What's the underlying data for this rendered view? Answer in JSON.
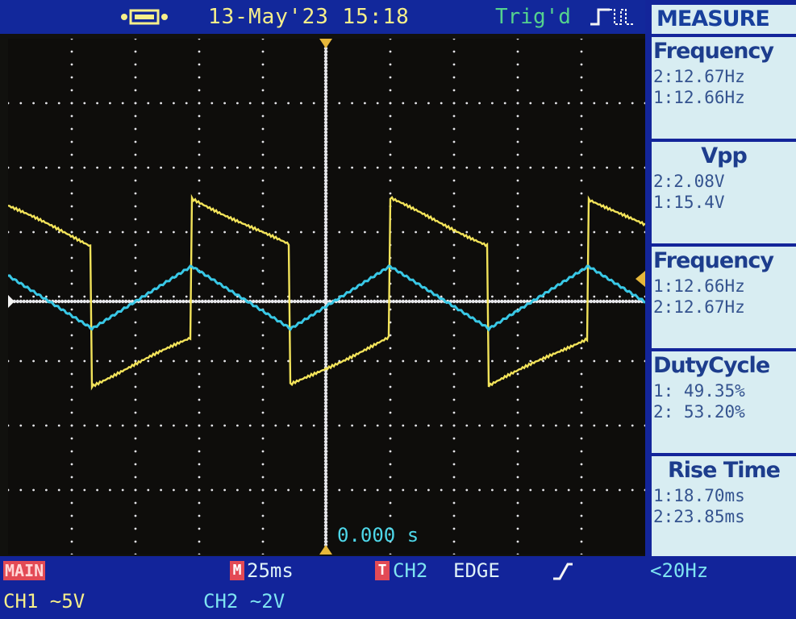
{
  "topbar": {
    "usb_icon": "usb-icon",
    "datetime": "13-May'23 15:18",
    "trig_status": "Trig'd",
    "trig_edge_icon": "rising-edge-icon"
  },
  "screen": {
    "time_offset": "0.000 s"
  },
  "measure": {
    "title": "MEASURE",
    "items": [
      {
        "name": "Frequency",
        "values": [
          "2:12.67Hz",
          "1:12.66Hz"
        ]
      },
      {
        "name": "Vpp",
        "values": [
          "2:2.08V",
          "1:15.4V"
        ]
      },
      {
        "name": "Frequency",
        "values": [
          "1:12.66Hz",
          "2:12.67Hz"
        ]
      },
      {
        "name": "DutyCycle",
        "values": [
          "1: 49.35%",
          "2: 53.20%"
        ]
      },
      {
        "name": "Rise Time",
        "values": [
          "1:18.70ms",
          "2:23.85ms"
        ]
      }
    ]
  },
  "bottombar": {
    "mode": "MAIN",
    "timebase_marker": "M",
    "timebase": "25ms",
    "trig_marker": "T",
    "trig_source": "CH2",
    "trig_type": "EDGE",
    "slope_icon": "rising-slope-icon",
    "trig_freq": "<20Hz",
    "ch1_scale": "CH1 ∼5V",
    "ch2_scale": "CH2 ∼2V"
  },
  "colors": {
    "ch1": "#f2e35a",
    "ch2": "#39c8e6",
    "grid": "#e6e6ea",
    "bar": "#12289b",
    "panel": "#d8edf2"
  }
}
